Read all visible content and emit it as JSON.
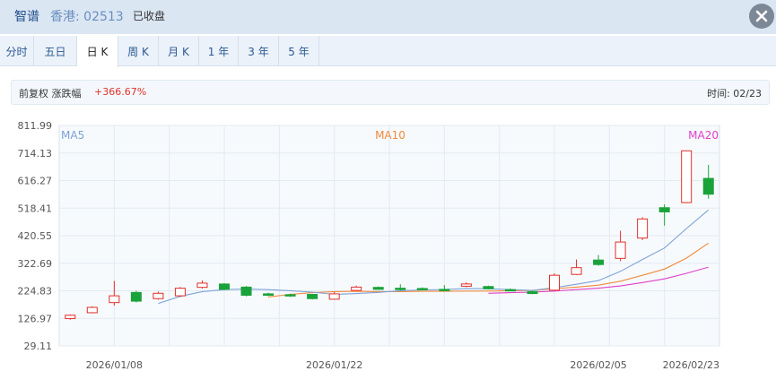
{
  "header": {
    "stock_name": "智谱",
    "market_code": "香港: 02513",
    "status": "已收盘",
    "close_icon": "close-icon"
  },
  "tabs": [
    {
      "label": "分时",
      "active": false
    },
    {
      "label": "五日",
      "active": false
    },
    {
      "label": "日 K",
      "active": true
    },
    {
      "label": "周 K",
      "active": false
    },
    {
      "label": "月 K",
      "active": false
    },
    {
      "label": "1 年",
      "active": false
    },
    {
      "label": "3 年",
      "active": false
    },
    {
      "label": "5 年",
      "active": false
    }
  ],
  "info": {
    "adjust_label": "前复权 涨跌幅",
    "change_value": "+366.67%",
    "time_label": "时间: 02/23"
  },
  "colors": {
    "up": "#e0302b",
    "down": "#1aa33a",
    "ma5": "#7da2d6",
    "ma10": "#f08a3c",
    "ma20": "#e040c8"
  },
  "chart_data": {
    "type": "candlestick",
    "y_ticks": [
      "811.99",
      "714.13",
      "616.27",
      "518.41",
      "420.55",
      "322.69",
      "224.83",
      "126.97",
      "29.11"
    ],
    "ylim": [
      29.11,
      811.99
    ],
    "x_ticks": [
      "2026/01/08",
      "2026/01/22",
      "2026/02/05",
      "2026/02/23"
    ],
    "x_tick_index": [
      2,
      12,
      24,
      34
    ],
    "legend": [
      "MA5",
      "MA10",
      "MA20"
    ],
    "grid": true,
    "candles": [
      {
        "o": 126,
        "c": 138,
        "h": 141,
        "l": 122
      },
      {
        "o": 147,
        "c": 166,
        "h": 170,
        "l": 145
      },
      {
        "o": 183,
        "c": 207,
        "h": 260,
        "l": 172
      },
      {
        "o": 219,
        "c": 188,
        "h": 225,
        "l": 184
      },
      {
        "o": 197,
        "c": 216,
        "h": 222,
        "l": 193
      },
      {
        "o": 207,
        "c": 234,
        "h": 238,
        "l": 203
      },
      {
        "o": 237,
        "c": 252,
        "h": 262,
        "l": 233
      },
      {
        "o": 249,
        "c": 230,
        "h": 252,
        "l": 227
      },
      {
        "o": 238,
        "c": 209,
        "h": 242,
        "l": 205
      },
      {
        "o": 214,
        "c": 209,
        "h": 218,
        "l": 206
      },
      {
        "o": 211,
        "c": 207,
        "h": 215,
        "l": 203
      },
      {
        "o": 212,
        "c": 197,
        "h": 214,
        "l": 194
      },
      {
        "o": 195,
        "c": 214,
        "h": 221,
        "l": 193
      },
      {
        "o": 226,
        "c": 238,
        "h": 243,
        "l": 224
      },
      {
        "o": 237,
        "c": 230,
        "h": 240,
        "l": 228
      },
      {
        "o": 234,
        "c": 229,
        "h": 248,
        "l": 226
      },
      {
        "o": 233,
        "c": 229,
        "h": 237,
        "l": 227
      },
      {
        "o": 230,
        "c": 228,
        "h": 245,
        "l": 226
      },
      {
        "o": 241,
        "c": 249,
        "h": 255,
        "l": 238
      },
      {
        "o": 240,
        "c": 232,
        "h": 243,
        "l": 230
      },
      {
        "o": 229,
        "c": 226,
        "h": 233,
        "l": 224
      },
      {
        "o": 222,
        "c": 215,
        "h": 225,
        "l": 213
      },
      {
        "o": 227,
        "c": 280,
        "h": 287,
        "l": 225
      },
      {
        "o": 283,
        "c": 307,
        "h": 336,
        "l": 281
      },
      {
        "o": 334,
        "c": 318,
        "h": 352,
        "l": 314
      },
      {
        "o": 340,
        "c": 398,
        "h": 438,
        "l": 330
      },
      {
        "o": 412,
        "c": 480,
        "h": 486,
        "l": 405
      },
      {
        "o": 520,
        "c": 505,
        "h": 532,
        "l": 456
      },
      {
        "o": 538,
        "c": 722,
        "h": 722,
        "l": 536
      },
      {
        "o": 624,
        "c": 568,
        "h": 672,
        "l": 552
      }
    ],
    "ma5": [
      null,
      null,
      null,
      null,
      180,
      205,
      222,
      229,
      231,
      229,
      225,
      220,
      212,
      215,
      219,
      225,
      228,
      229,
      233,
      232,
      229,
      226,
      236,
      248,
      261,
      294,
      336,
      377,
      446,
      512
    ],
    "ma10": [
      null,
      null,
      null,
      null,
      null,
      null,
      null,
      null,
      null,
      203,
      212,
      218,
      222,
      223,
      222,
      222,
      223,
      223,
      224,
      224,
      225,
      226,
      232,
      238,
      245,
      259,
      280,
      302,
      341,
      394
    ],
    "ma20": [
      null,
      null,
      null,
      null,
      null,
      null,
      null,
      null,
      null,
      null,
      null,
      null,
      null,
      null,
      null,
      null,
      null,
      null,
      null,
      216,
      218,
      220,
      224,
      229,
      234,
      242,
      254,
      267,
      287,
      309
    ]
  }
}
